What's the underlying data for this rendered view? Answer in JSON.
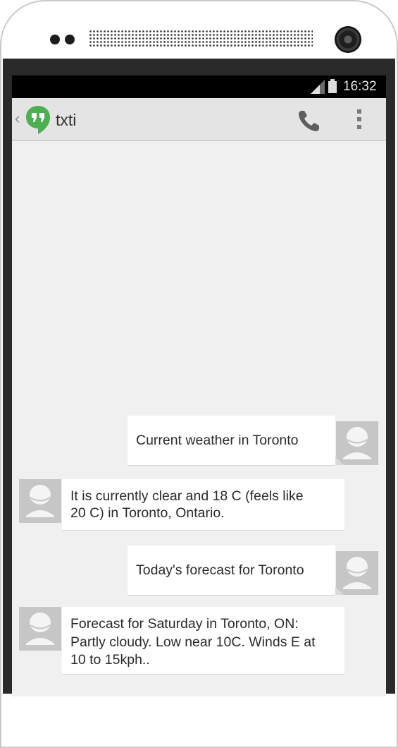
{
  "status_bar": {
    "time": "16:32",
    "signal_icon": "signal-icon",
    "battery_icon": "battery-icon"
  },
  "action_bar": {
    "back_icon": "chevron-left-icon",
    "app_icon": "hangouts-icon",
    "title": "txti",
    "call_icon": "phone-icon",
    "menu_icon": "overflow-menu-icon"
  },
  "messages": [
    {
      "direction": "outgoing",
      "text": "Current weather in Toronto"
    },
    {
      "direction": "incoming",
      "lines": [
        "It is currently clear and 18 C (feels like",
        "20 C) in Toronto, Ontario."
      ]
    },
    {
      "direction": "outgoing",
      "text": "Today's forecast for Toronto"
    },
    {
      "direction": "incoming",
      "lines": [
        "Forecast for Saturday in Toronto, ON:",
        "Partly cloudy. Low near 10C. Winds E at",
        "10 to 15kph.."
      ]
    }
  ],
  "colors": {
    "screen_bg": "#f0f0f0",
    "action_bar": "#e4e4e4",
    "bubble": "#ffffff",
    "avatar": "#c6c6c6",
    "hangouts_green": "#4caf50"
  }
}
